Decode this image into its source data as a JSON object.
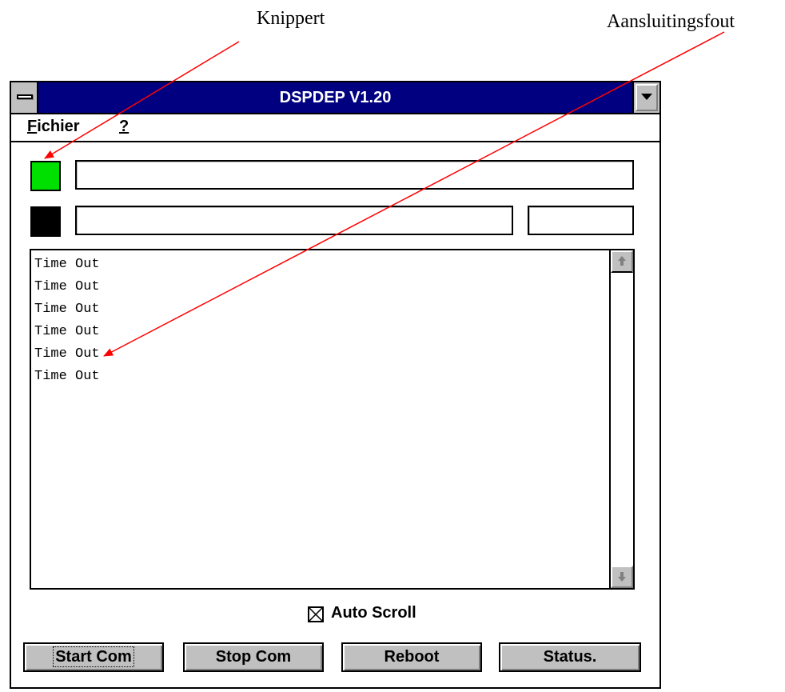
{
  "annotations": {
    "blinks": "Knippert",
    "connection_error": "Aansluitingsfout"
  },
  "window": {
    "title": "DSPDEP V1.20"
  },
  "menu": {
    "file_hotkey": "F",
    "file_rest": "ichier",
    "help": "?"
  },
  "indicators": {
    "lamp_top_color": "#00e000",
    "lamp_bottom_color": "#000000"
  },
  "fields": {
    "field1_value": "",
    "field2_value": "",
    "field3_value": ""
  },
  "log": {
    "lines": [
      "Time Out",
      "Time Out",
      "Time Out",
      "Time Out",
      "Time Out",
      "Time Out"
    ]
  },
  "auto_scroll": {
    "label": "Auto Scroll",
    "checked": true
  },
  "buttons": {
    "start": "Start Com",
    "stop": "Stop Com",
    "reboot": "Reboot",
    "status": "Status."
  },
  "colors": {
    "titlebar": "#000080",
    "annotation_arrow": "#ff0000"
  }
}
